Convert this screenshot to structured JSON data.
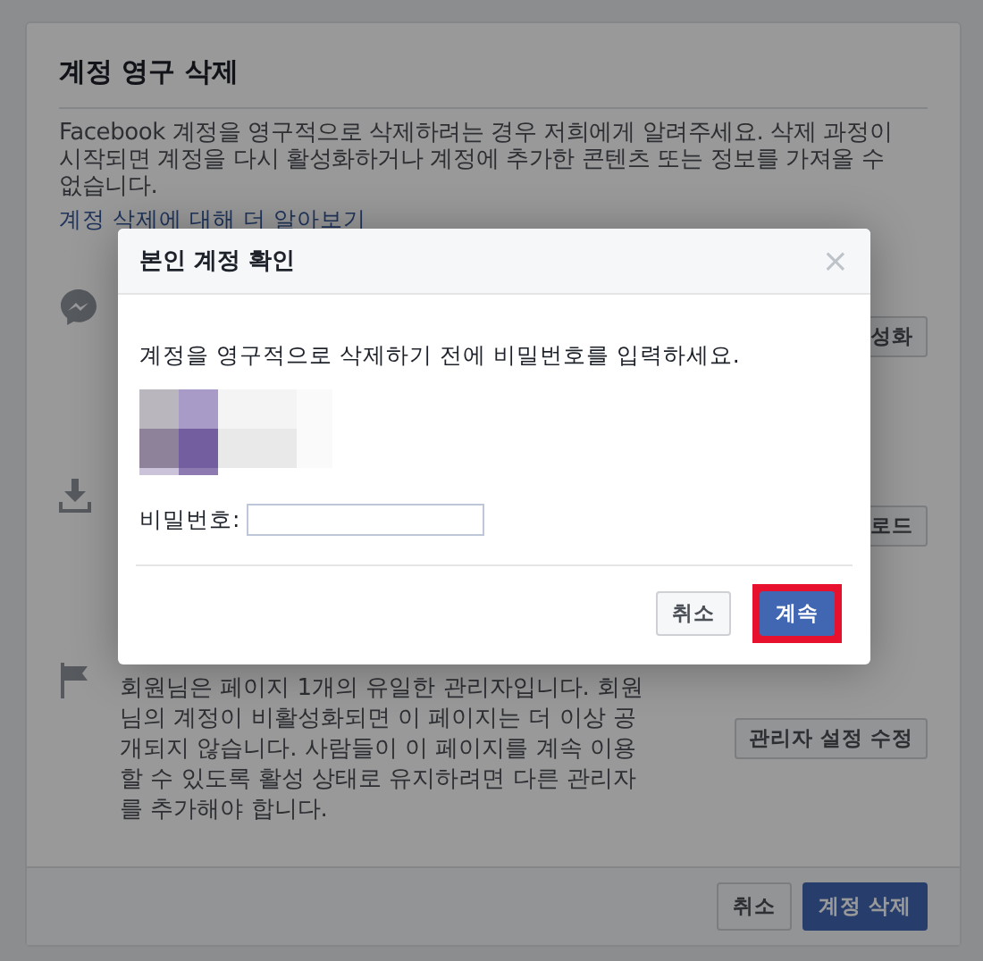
{
  "page": {
    "title": "계정 영구 삭제",
    "description": "Facebook 계정을 영구적으로 삭제하려는 경우 저희에게 알려주세요. 삭제 과정이 시작되면 계정을 다시 활성화하거나 계정에 추가한 콘텐츠 또는 정보를 가져올 수 없습니다.",
    "link": "계정 삭제에 대해 더 알아보기",
    "rows": [
      {
        "kind": "messenger",
        "button": "성화"
      },
      {
        "kind": "download",
        "button": "로드"
      },
      {
        "kind": "flag",
        "text": "회원님은 페이지 1개의 유일한 관리자입니다. 회원님의 계정이 비활성화되면 이 페이지는 더 이상 공개되지 않습니다. 사람들이 이 페이지를 계속 이용할 수 있도록 활성 상태로 유지하려면 다른 관리자를 추가해야 합니다.",
        "button": "관리자 설정 수정"
      }
    ],
    "footer_buttons": [
      {
        "label": "취소",
        "kind": "secondary"
      },
      {
        "label": "계정 삭제",
        "kind": "primary"
      }
    ]
  },
  "dialog": {
    "title": "본인 계정 확인",
    "close": "×",
    "message": "계정을 영구적으로 삭제하기 전에 비밀번호를 입력하세요.",
    "password_label": "비밀번호:",
    "buttons": [
      {
        "label": "취소",
        "kind": "secondary",
        "highlighted": false
      },
      {
        "label": "계속",
        "kind": "primary",
        "highlighted": true
      }
    ]
  }
}
